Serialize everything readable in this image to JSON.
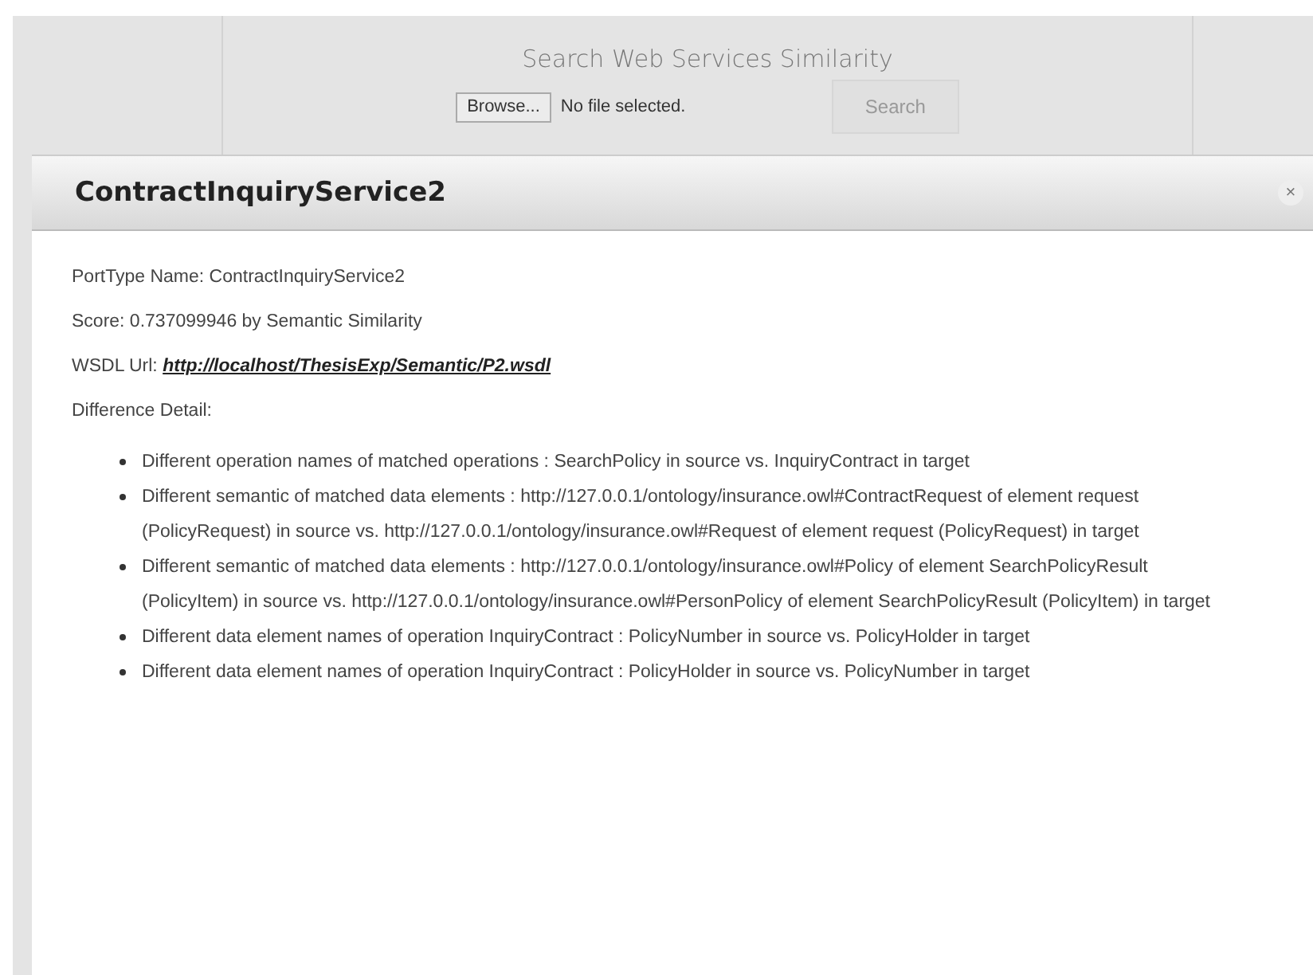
{
  "search_panel": {
    "title": "Search Web Services Similarity",
    "browse_button": "Browse...",
    "file_status": "No file selected.",
    "search_button": "Search"
  },
  "dialog": {
    "title": "ContractInquiryService2",
    "close": "×",
    "porttype": "PortType Name: ContractInquiryService2",
    "score": "Score: 0.737099946 by Semantic Similarity",
    "wsdl_label": "WSDL Url:",
    "wsdl_link": "http://localhost/ThesisExp/Semantic/P2.wsdl",
    "difference_label": "Difference Detail:",
    "differences": [
      "Different operation names of matched operations : SearchPolicy in source vs. InquiryContract in target",
      "Different semantic of matched data elements : http://127.0.0.1/ontology/insurance.owl#ContractRequest of element request (PolicyRequest) in source vs. http://127.0.0.1/ontology/insurance.owl#Request of element request (PolicyRequest) in target",
      "Different semantic of matched data elements : http://127.0.0.1/ontology/insurance.owl#Policy of element SearchPolicyResult (PolicyItem) in source vs. http://127.0.0.1/ontology/insurance.owl#PersonPolicy of element SearchPolicyResult (PolicyItem) in target",
      "Different data element names of operation InquiryContract : PolicyNumber in source vs. PolicyHolder in target",
      "Different data element names of operation InquiryContract : PolicyHolder in source vs. PolicyNumber in target"
    ]
  }
}
